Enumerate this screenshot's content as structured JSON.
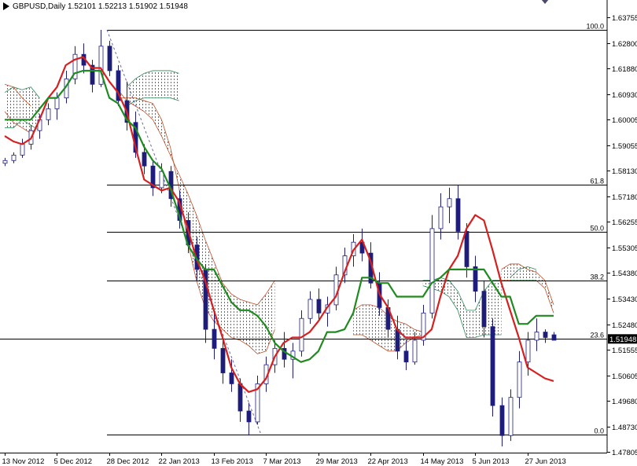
{
  "header": {
    "symbol": "GBPUSD,Daily",
    "ohlc": "1.52101 1.52213 1.51902 1.51948"
  },
  "colors": {
    "candle": "#1e1e7a",
    "tenkan": "#d61f1f",
    "kijun": "#1f8a1f",
    "cloud_bear": "#c0502a",
    "cloud_bull": "#2e8b57",
    "fib_line": "#000000",
    "grid_axis": "#000000"
  },
  "chart_data": {
    "type": "line",
    "title": "GBPUSD,Daily",
    "instrument": "GBPUSD",
    "timeframe": "Daily",
    "current_price": "1.51948",
    "current_price_value": 1.51948,
    "ylim": [
      1.478,
      1.6405
    ],
    "y_ticks": [
      "1.63755",
      "1.62800",
      "1.61880",
      "1.60930",
      "1.60005",
      "1.59055",
      "1.58130",
      "1.57180",
      "1.56255",
      "1.55305",
      "1.54380",
      "1.53430",
      "1.52480",
      "1.51555",
      "1.50605",
      "1.49680",
      "1.48730",
      "1.47805"
    ],
    "x_ticks": [
      "13 Nov 2012",
      "5 Dec 2012",
      "28 Dec 2012",
      "22 Jan 2013",
      "13 Feb 2013",
      "7 Mar 2013",
      "29 Mar 2013",
      "22 Apr 2013",
      "14 May 2013",
      "5 Jun 2013",
      "27 Jun 2013"
    ],
    "fibonacci": [
      {
        "label": "100.0",
        "price": 1.633
      },
      {
        "label": "61.8",
        "price": 1.576
      },
      {
        "label": "50.0",
        "price": 1.5588
      },
      {
        "label": "38.2",
        "price": 1.541
      },
      {
        "label": "23.6",
        "price": 1.5195
      },
      {
        "label": "0.0",
        "price": 1.4843
      }
    ],
    "series": [
      {
        "name": "Tenkan-sen",
        "values": [
          1.594,
          1.592,
          1.591,
          1.593,
          1.6,
          1.608,
          1.612,
          1.62,
          1.622,
          1.623,
          1.619,
          1.619,
          1.614,
          1.61,
          1.603,
          1.59,
          1.578,
          1.576,
          1.574,
          1.575,
          1.57,
          1.56,
          1.549,
          1.541,
          1.53,
          1.52,
          1.509,
          1.503,
          1.5,
          1.501,
          1.505,
          1.513,
          1.518,
          1.52,
          1.52,
          1.522,
          1.526,
          1.531,
          1.535,
          1.544,
          1.552,
          1.556,
          1.548,
          1.536,
          1.531,
          1.523,
          1.52,
          1.52,
          1.52,
          1.523,
          1.535,
          1.545,
          1.55,
          1.56,
          1.565,
          1.563,
          1.552,
          1.54,
          1.53,
          1.52,
          1.509,
          1.507,
          1.505,
          1.504
        ]
      },
      {
        "name": "Kijun-sen",
        "values": [
          1.6,
          1.6,
          1.6,
          1.6,
          1.604,
          1.608,
          1.608,
          1.612,
          1.617,
          1.618,
          1.618,
          1.618,
          1.608,
          1.606,
          1.6,
          1.597,
          1.59,
          1.585,
          1.582,
          1.575,
          1.565,
          1.554,
          1.549,
          1.545,
          1.545,
          1.539,
          1.533,
          1.53,
          1.53,
          1.528,
          1.524,
          1.518,
          1.515,
          1.513,
          1.511,
          1.512,
          1.515,
          1.522,
          1.522,
          1.523,
          1.529,
          1.542,
          1.542,
          1.54,
          1.54,
          1.535,
          1.535,
          1.535,
          1.535,
          1.54,
          1.542,
          1.545,
          1.545,
          1.545,
          1.545,
          1.545,
          1.54,
          1.535,
          1.535,
          1.525,
          1.525,
          1.528,
          1.528,
          1.528
        ]
      }
    ],
    "cloud_bear_segments": [
      {
        "upper": [
          1.613,
          1.612,
          1.608,
          1.605
        ],
        "lower": [
          1.603,
          1.599,
          1.597,
          1.595
        ]
      },
      {
        "upper": [
          1.611,
          1.607,
          1.605,
          1.603,
          1.6,
          1.594,
          1.587,
          1.58,
          1.573,
          1.565,
          1.556,
          1.548,
          1.54,
          1.536,
          1.534,
          1.533,
          1.532,
          1.536,
          1.541
        ],
        "lower": [
          1.608,
          1.608,
          1.608,
          1.607,
          1.606,
          1.6,
          1.59,
          1.575,
          1.555,
          1.541,
          1.531,
          1.526,
          1.523,
          1.52,
          1.519,
          1.517,
          1.514,
          1.515,
          1.523
        ]
      },
      {
        "upper": [
          1.53,
          1.532,
          1.532,
          1.531,
          1.528,
          1.526,
          1.525,
          1.523,
          1.522
        ],
        "lower": [
          1.521,
          1.521,
          1.519,
          1.517,
          1.515,
          1.515,
          1.518,
          1.52,
          1.521
        ]
      },
      {
        "upper": [
          1.545,
          1.547,
          1.547,
          1.545,
          1.544,
          1.541,
          1.532
        ],
        "lower": [
          1.541,
          1.541,
          1.541,
          1.541,
          1.541,
          1.538,
          1.529
        ]
      }
    ],
    "cloud_bull_segments": [
      {
        "upper": [
          1.61,
          1.612,
          1.611,
          1.612,
          1.608
        ],
        "lower": [
          1.597,
          1.597,
          1.6,
          1.598,
          1.596
        ]
      },
      {
        "upper": [
          1.612,
          1.615,
          1.617,
          1.618,
          1.618,
          1.618,
          1.617
        ],
        "lower": [
          1.605,
          1.607,
          1.608,
          1.608,
          1.608,
          1.608,
          1.607
        ]
      },
      {
        "upper": [
          1.541,
          1.541,
          1.542,
          1.541,
          1.537,
          1.53,
          1.53,
          1.537,
          1.541,
          1.541
        ],
        "lower": [
          1.539,
          1.538,
          1.537,
          1.535,
          1.53,
          1.52,
          1.52,
          1.521,
          1.521,
          1.521
        ]
      },
      {
        "upper": [
          1.542,
          1.545,
          1.546,
          1.545
        ],
        "lower": [
          1.541,
          1.541,
          1.541,
          1.541
        ]
      }
    ],
    "candles": [
      [
        1.584,
        1.586,
        1.583,
        1.585
      ],
      [
        1.585,
        1.588,
        1.584,
        1.587
      ],
      [
        1.587,
        1.593,
        1.586,
        1.591
      ],
      [
        1.591,
        1.598,
        1.589,
        1.596
      ],
      [
        1.596,
        1.602,
        1.593,
        1.6
      ],
      [
        1.6,
        1.606,
        1.598,
        1.604
      ],
      [
        1.604,
        1.61,
        1.6,
        1.608
      ],
      [
        1.608,
        1.618,
        1.606,
        1.615
      ],
      [
        1.615,
        1.627,
        1.613,
        1.624
      ],
      [
        1.624,
        1.628,
        1.617,
        1.62
      ],
      [
        1.62,
        1.622,
        1.61,
        1.613
      ],
      [
        1.613,
        1.633,
        1.612,
        1.627
      ],
      [
        1.627,
        1.629,
        1.616,
        1.618
      ],
      [
        1.618,
        1.62,
        1.605,
        1.607
      ],
      [
        1.607,
        1.614,
        1.596,
        1.599
      ],
      [
        1.599,
        1.603,
        1.586,
        1.588
      ],
      [
        1.588,
        1.591,
        1.58,
        1.583
      ],
      [
        1.583,
        1.585,
        1.572,
        1.575
      ],
      [
        1.575,
        1.584,
        1.573,
        1.581
      ],
      [
        1.581,
        1.583,
        1.568,
        1.571
      ],
      [
        1.571,
        1.574,
        1.56,
        1.563
      ],
      [
        1.563,
        1.566,
        1.551,
        1.554
      ],
      [
        1.554,
        1.557,
        1.541,
        1.545
      ],
      [
        1.545,
        1.547,
        1.518,
        1.523
      ],
      [
        1.523,
        1.53,
        1.512,
        1.516
      ],
      [
        1.516,
        1.52,
        1.503,
        1.507
      ],
      [
        1.507,
        1.512,
        1.5,
        1.503
      ],
      [
        1.503,
        1.505,
        1.489,
        1.493
      ],
      [
        1.493,
        1.496,
        1.484,
        1.489
      ],
      [
        1.489,
        1.506,
        1.488,
        1.503
      ],
      [
        1.503,
        1.513,
        1.5,
        1.51
      ],
      [
        1.51,
        1.519,
        1.507,
        1.516
      ],
      [
        1.516,
        1.522,
        1.509,
        1.512
      ],
      [
        1.512,
        1.518,
        1.505,
        1.515
      ],
      [
        1.515,
        1.53,
        1.513,
        1.527
      ],
      [
        1.527,
        1.537,
        1.525,
        1.534
      ],
      [
        1.534,
        1.538,
        1.526,
        1.529
      ],
      [
        1.529,
        1.535,
        1.524,
        1.532
      ],
      [
        1.532,
        1.546,
        1.53,
        1.543
      ],
      [
        1.543,
        1.553,
        1.54,
        1.55
      ],
      [
        1.55,
        1.558,
        1.546,
        1.555
      ],
      [
        1.555,
        1.56,
        1.548,
        1.551
      ],
      [
        1.551,
        1.555,
        1.538,
        1.54
      ],
      [
        1.54,
        1.544,
        1.528,
        1.531
      ],
      [
        1.531,
        1.534,
        1.52,
        1.523
      ],
      [
        1.523,
        1.528,
        1.512,
        1.515
      ],
      [
        1.515,
        1.519,
        1.508,
        1.511
      ],
      [
        1.511,
        1.522,
        1.51,
        1.519
      ],
      [
        1.519,
        1.532,
        1.517,
        1.529
      ],
      [
        1.529,
        1.565,
        1.527,
        1.56
      ],
      [
        1.56,
        1.573,
        1.556,
        1.568
      ],
      [
        1.568,
        1.575,
        1.562,
        1.571
      ],
      [
        1.571,
        1.576,
        1.556,
        1.559
      ],
      [
        1.559,
        1.562,
        1.542,
        1.546
      ],
      [
        1.546,
        1.55,
        1.533,
        1.537
      ],
      [
        1.537,
        1.541,
        1.52,
        1.524
      ],
      [
        1.524,
        1.527,
        1.491,
        1.495
      ],
      [
        1.495,
        1.498,
        1.48,
        1.484
      ],
      [
        1.484,
        1.501,
        1.482,
        1.498
      ],
      [
        1.498,
        1.515,
        1.494,
        1.511
      ],
      [
        1.511,
        1.522,
        1.506,
        1.519
      ],
      [
        1.519,
        1.527,
        1.515,
        1.522
      ],
      [
        1.522,
        1.523,
        1.518,
        1.52
      ],
      [
        1.521,
        1.522,
        1.519,
        1.519
      ]
    ]
  }
}
